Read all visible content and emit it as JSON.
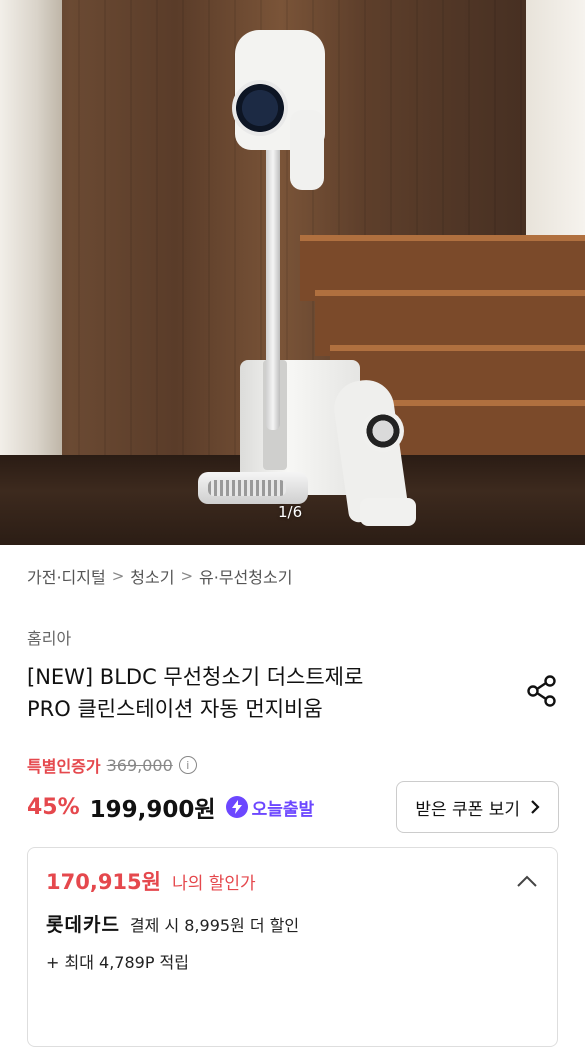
{
  "gallery": {
    "counter": "1/6"
  },
  "breadcrumb": [
    "가전·디지털",
    "청소기",
    "유·무선청소기"
  ],
  "product": {
    "brand": "홈리아",
    "title_line1": "[NEW] BLDC 무선청소기 더스트제로",
    "title_line2": "PRO 클린스테이션 자동 먼지비움"
  },
  "pricing": {
    "special_label": "특별인증가",
    "original_price": "369,000",
    "discount": "45%",
    "sale_price": "199,900원",
    "today_delivery": "오늘출발",
    "coupon_button": "받은 쿠폰 보기"
  },
  "my_price": {
    "price": "170,915원",
    "label": "나의 할인가",
    "card_brand": "롯데카드",
    "card_discount": "결제 시 8,995원 더 할인",
    "points": "+ 최대 4,789P 적립"
  },
  "colors": {
    "accent_red": "#e5484d",
    "delivery_purple": "#6c47ff"
  }
}
